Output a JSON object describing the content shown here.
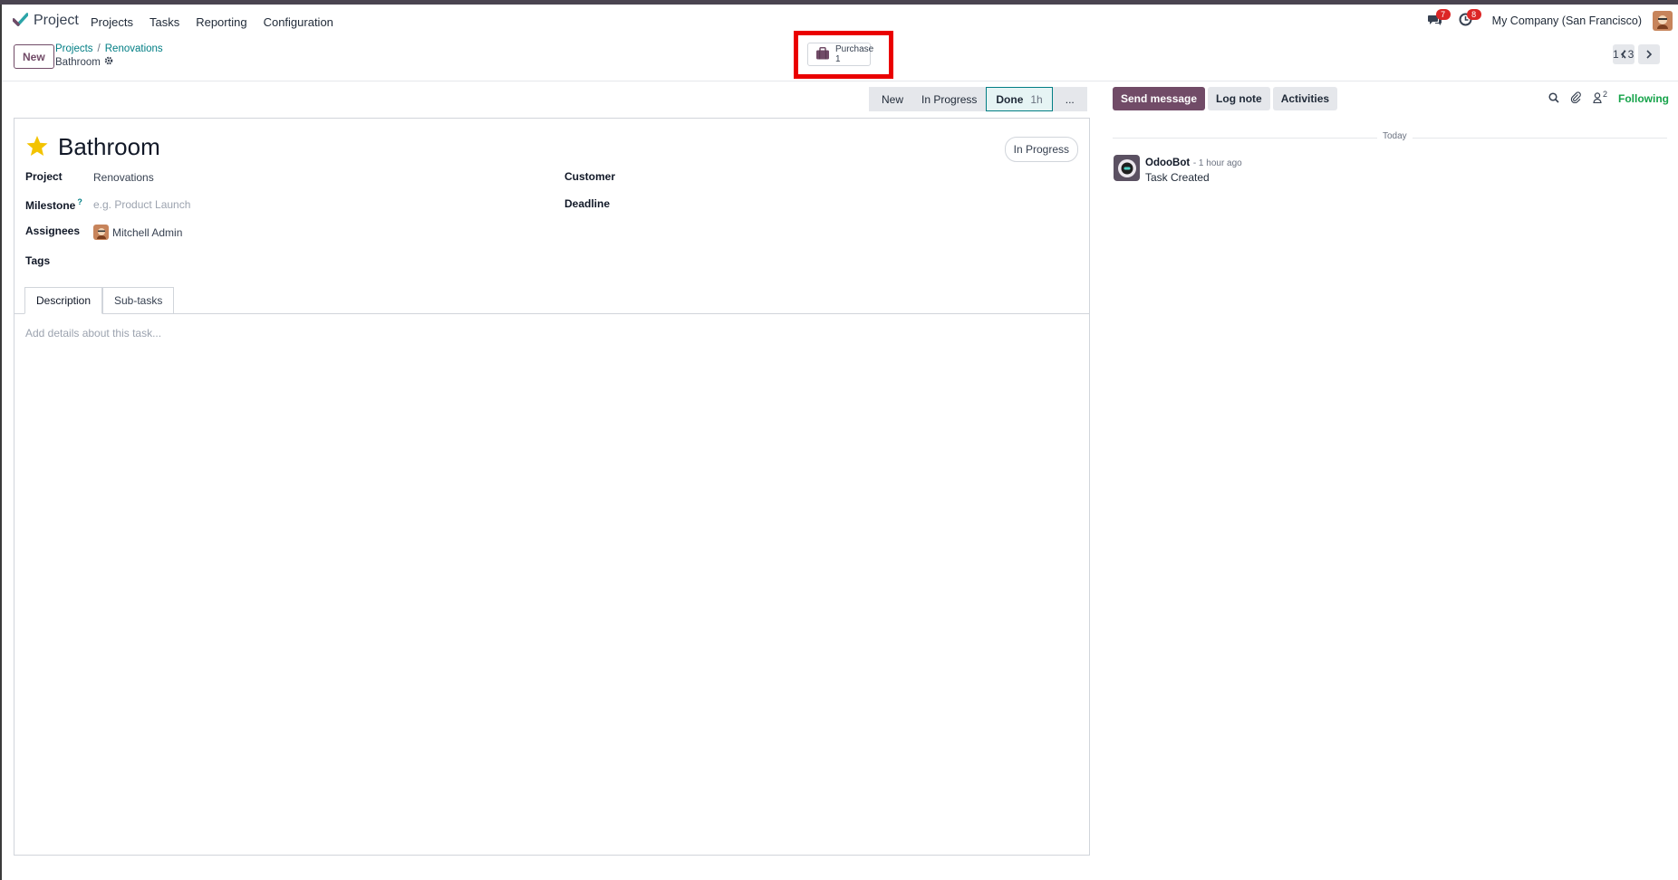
{
  "navbar": {
    "app_name": "Project",
    "menu": [
      "Projects",
      "Tasks",
      "Reporting",
      "Configuration"
    ],
    "messages_count": "7",
    "activities_count": "8",
    "company": "My Company (San Francisco)"
  },
  "control_panel": {
    "new_label": "New",
    "breadcrumb": [
      "Projects",
      "Renovations"
    ],
    "current": "Bathroom",
    "smart_button": {
      "label": "Purchase",
      "count": "1"
    },
    "pager": "1 / 3"
  },
  "status_bar": {
    "stages": [
      "New",
      "In Progress",
      "Done"
    ],
    "done_duration": "1h",
    "more_label": "..."
  },
  "task": {
    "title": "Bathroom",
    "state": "In Progress",
    "fields": {
      "project_label": "Project",
      "project_value": "Renovations",
      "milestone_label": "Milestone",
      "milestone_help": "?",
      "milestone_placeholder": "e.g. Product Launch",
      "assignees_label": "Assignees",
      "assignee": "Mitchell Admin",
      "tags_label": "Tags",
      "customer_label": "Customer",
      "deadline_label": "Deadline"
    },
    "tabs": [
      "Description",
      "Sub-tasks"
    ],
    "description_placeholder": "Add details about this task..."
  },
  "chatter": {
    "send_message": "Send message",
    "log_note": "Log note",
    "activities": "Activities",
    "followers_count": "2",
    "following": "Following",
    "date_separator": "Today",
    "messages": [
      {
        "author": "OdooBot",
        "time": "- 1 hour ago",
        "body": "Task Created"
      }
    ]
  }
}
